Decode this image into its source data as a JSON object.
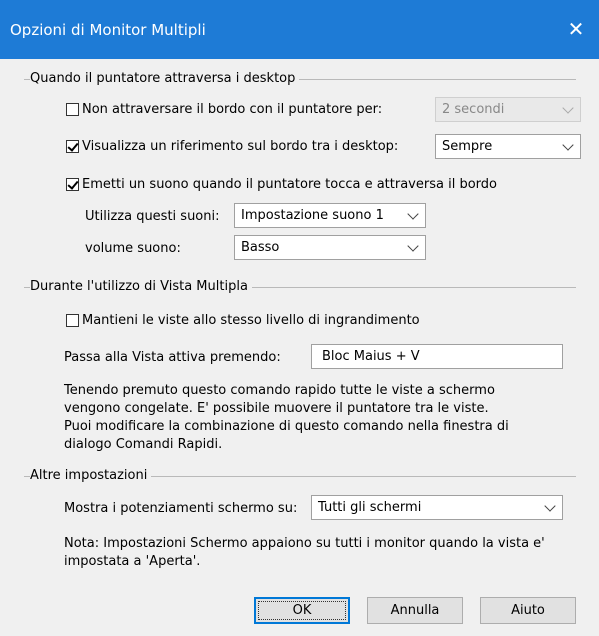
{
  "window": {
    "title": "Opzioni di Monitor Multipli",
    "close_icon": "close-icon"
  },
  "group_desktop": {
    "label": "Quando il puntatore attraversa i desktop",
    "no_cross": {
      "label": "Non attraversare il bordo con il puntatore per:",
      "checked": false,
      "select_value": "2 secondi",
      "disabled": true
    },
    "show_ref": {
      "label": "Visualizza un riferimento sul bordo tra i desktop:",
      "checked": true,
      "select_value": "Sempre"
    },
    "sound": {
      "label": "Emetti un suono quando il puntatore tocca e attraversa il bordo",
      "checked": true
    },
    "use_sounds": {
      "label": "Utilizza questi suoni:",
      "value": "Impostazione suono 1"
    },
    "volume": {
      "label": "volume suono:",
      "value": "Basso"
    }
  },
  "group_vista": {
    "label": "Durante l'utilizzo di Vista Multipla",
    "keep_zoom": {
      "label": "Mantieni le viste allo stesso livello di ingrandimento",
      "checked": false
    },
    "switch": {
      "label": "Passa alla Vista attiva premendo:",
      "value": "Bloc Maius + V"
    },
    "description": [
      "Tenendo premuto questo comando rapido tutte le viste a schermo",
      "vengono congelate. E' possibile muovere il puntatore tra le viste.",
      "Puoi modificare la combinazione di questo comando nella finestra di",
      "dialogo Comandi Rapidi."
    ]
  },
  "group_other": {
    "label": "Altre impostazioni",
    "show_enh": {
      "label": "Mostra i potenziamenti schermo su:",
      "value": "Tutti gli schermi"
    },
    "note": [
      "Nota: Impostazioni Schermo appaiono su tutti i monitor quando la vista e'",
      "impostata a 'Aperta'."
    ]
  },
  "buttons": {
    "ok": "OK",
    "cancel": "Annulla",
    "help": "Aiuto"
  }
}
